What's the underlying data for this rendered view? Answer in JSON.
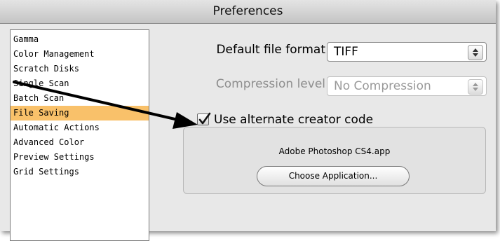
{
  "window": {
    "title": "Preferences"
  },
  "sidebar": {
    "items": [
      {
        "label": "Gamma",
        "selected": false
      },
      {
        "label": "Color Management",
        "selected": false
      },
      {
        "label": "Scratch Disks",
        "selected": false
      },
      {
        "label": "Single Scan",
        "selected": false
      },
      {
        "label": "Batch Scan",
        "selected": false
      },
      {
        "label": "File Saving",
        "selected": true
      },
      {
        "label": "Automatic Actions",
        "selected": false
      },
      {
        "label": "Advanced Color",
        "selected": false
      },
      {
        "label": "Preview Settings",
        "selected": false
      },
      {
        "label": "Grid Settings",
        "selected": false
      }
    ],
    "selected_color": "#f9c16a"
  },
  "settings": {
    "default_format_label": "Default file format",
    "default_format_value": "TIFF",
    "compression_label": "Compression level",
    "compression_value": "No Compression",
    "compression_enabled": false,
    "alt_creator_label": "Use alternate creator code",
    "alt_creator_checked": true,
    "app_name": "Adobe Photoshop CS4.app",
    "choose_button": "Choose Application..."
  },
  "icons": [
    "popup-arrows-icon",
    "checkmark-icon",
    "callout-arrow"
  ]
}
